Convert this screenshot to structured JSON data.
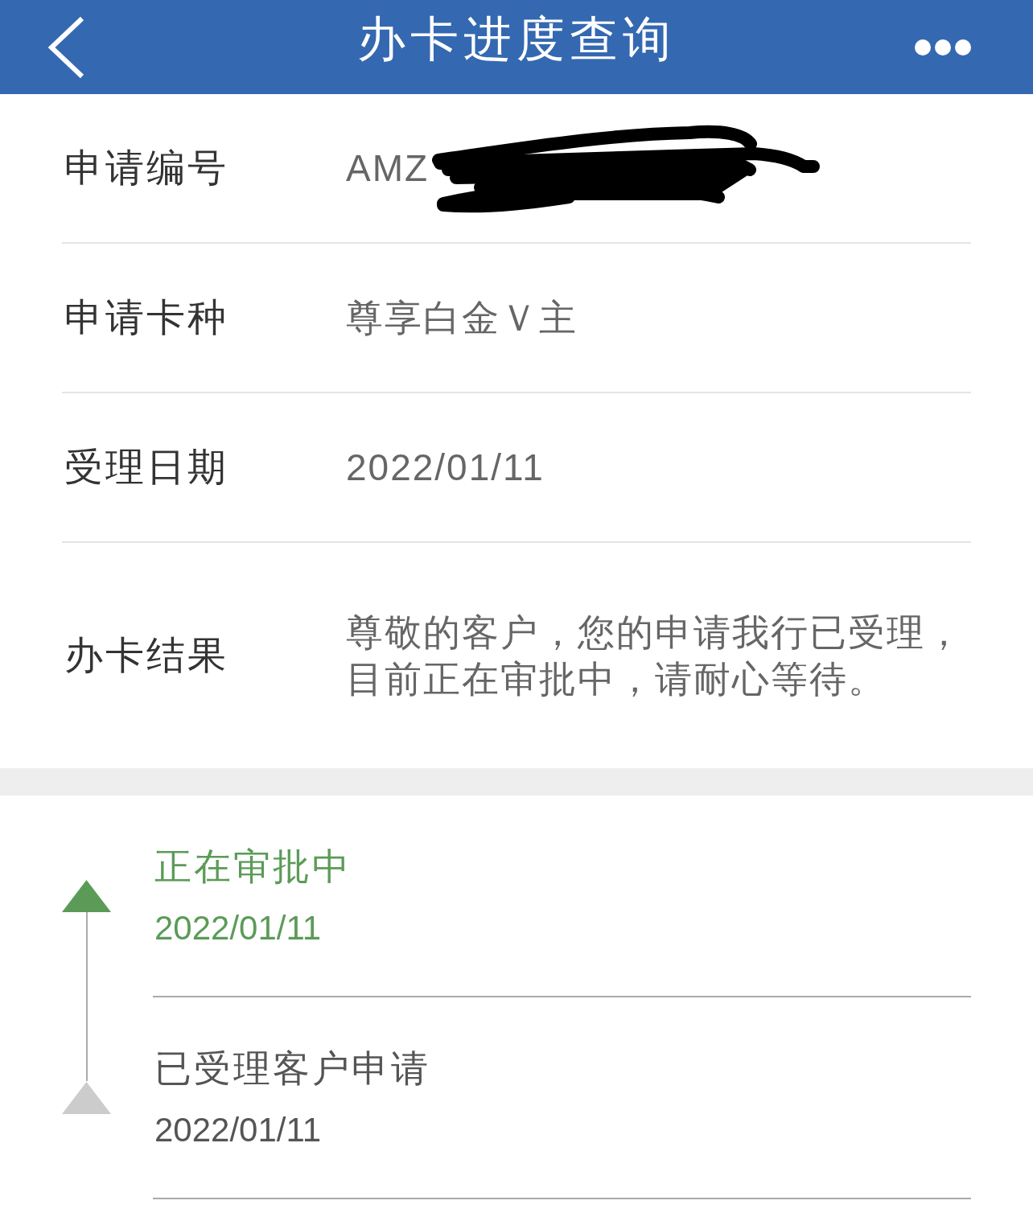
{
  "header": {
    "title": "办卡进度查询"
  },
  "details": [
    {
      "label": "申请编号",
      "value": "AMZ",
      "redacted": true
    },
    {
      "label": "申请卡种",
      "value": "尊享白金Ｖ主",
      "redacted": false
    },
    {
      "label": "受理日期",
      "value": "2022/01/11",
      "redacted": false
    },
    {
      "label": "办卡结果",
      "value": "尊敬的客户，您的申请我行已受理，目前正在审批中，请耐心等待。",
      "redacted": false
    }
  ],
  "timeline": [
    {
      "title": "正在审批中",
      "date": "2022/01/11",
      "active": true
    },
    {
      "title": "已受理客户申请",
      "date": "2022/01/11",
      "active": false
    }
  ]
}
